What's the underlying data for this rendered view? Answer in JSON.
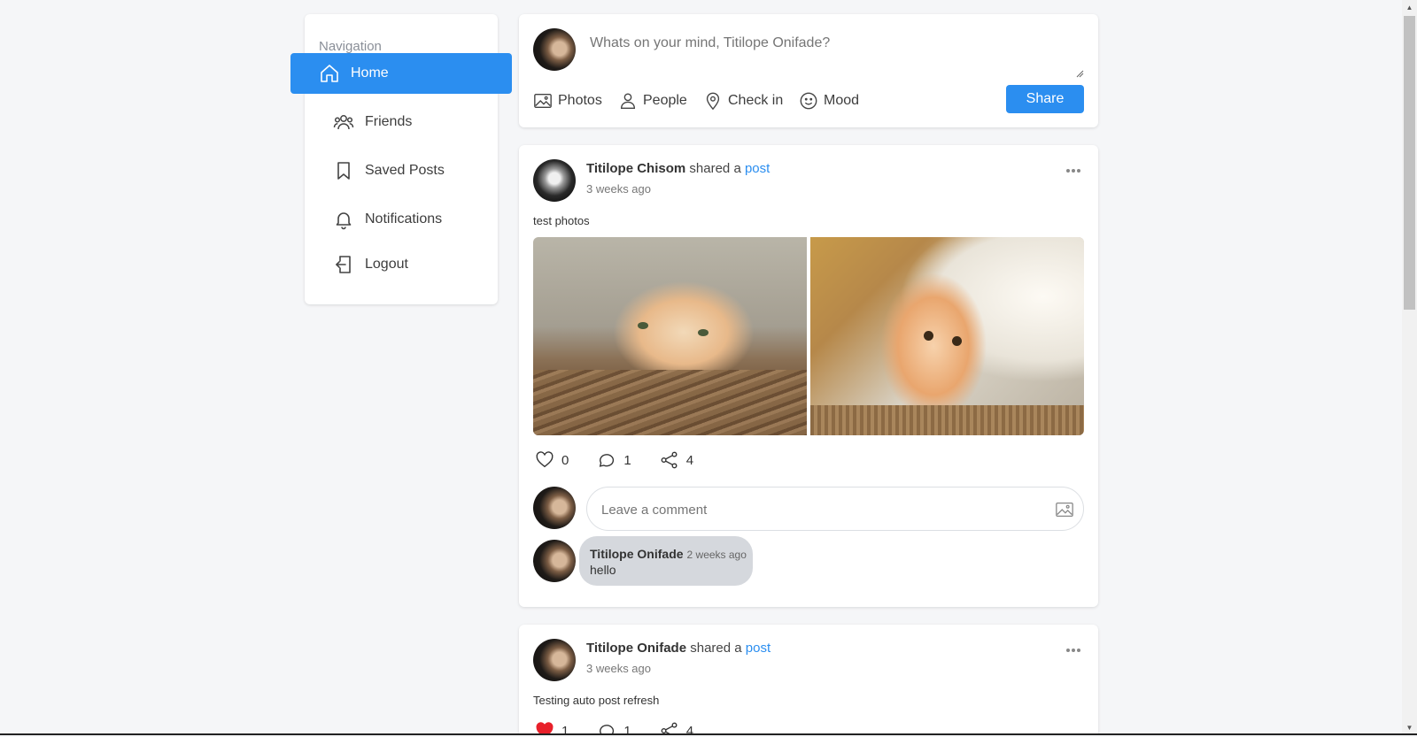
{
  "sidebar": {
    "title": "Navigation",
    "items": [
      {
        "label": "Home",
        "icon": "home-icon",
        "active": true
      },
      {
        "label": "Friends",
        "icon": "users-icon"
      },
      {
        "label": "Saved Posts",
        "icon": "bookmark-icon"
      },
      {
        "label": "Notifications",
        "icon": "bell-icon"
      },
      {
        "label": "Logout",
        "icon": "logout-icon"
      }
    ]
  },
  "composer": {
    "placeholder": "Whats on your mind, Titilope Onifade?",
    "actions": [
      {
        "label": "Photos",
        "icon": "image-icon"
      },
      {
        "label": "People",
        "icon": "person-icon"
      },
      {
        "label": "Check in",
        "icon": "map-pin-icon"
      },
      {
        "label": "Mood",
        "icon": "smiley-icon"
      }
    ],
    "share_label": "Share"
  },
  "posts": [
    {
      "author": "Titilope Chisom",
      "shared_text": "shared a",
      "link_text": "post",
      "time": "3 weeks ago",
      "text": "test photos",
      "likes": "0",
      "comments": "1",
      "shares": "4",
      "comment_placeholder": "Leave a comment",
      "comment": {
        "author": "Titilope Onifade",
        "time": "2 weeks ago",
        "text": "hello"
      }
    },
    {
      "author": "Titilope Onifade",
      "shared_text": "shared a",
      "link_text": "post",
      "time": "3 weeks ago",
      "text": "Testing auto post refresh",
      "likes": "1",
      "comments": "1",
      "shares": "4"
    }
  ],
  "colors": {
    "accent": "#2b8ef0",
    "background": "#f5f6f8",
    "liked": "#e8202a"
  }
}
